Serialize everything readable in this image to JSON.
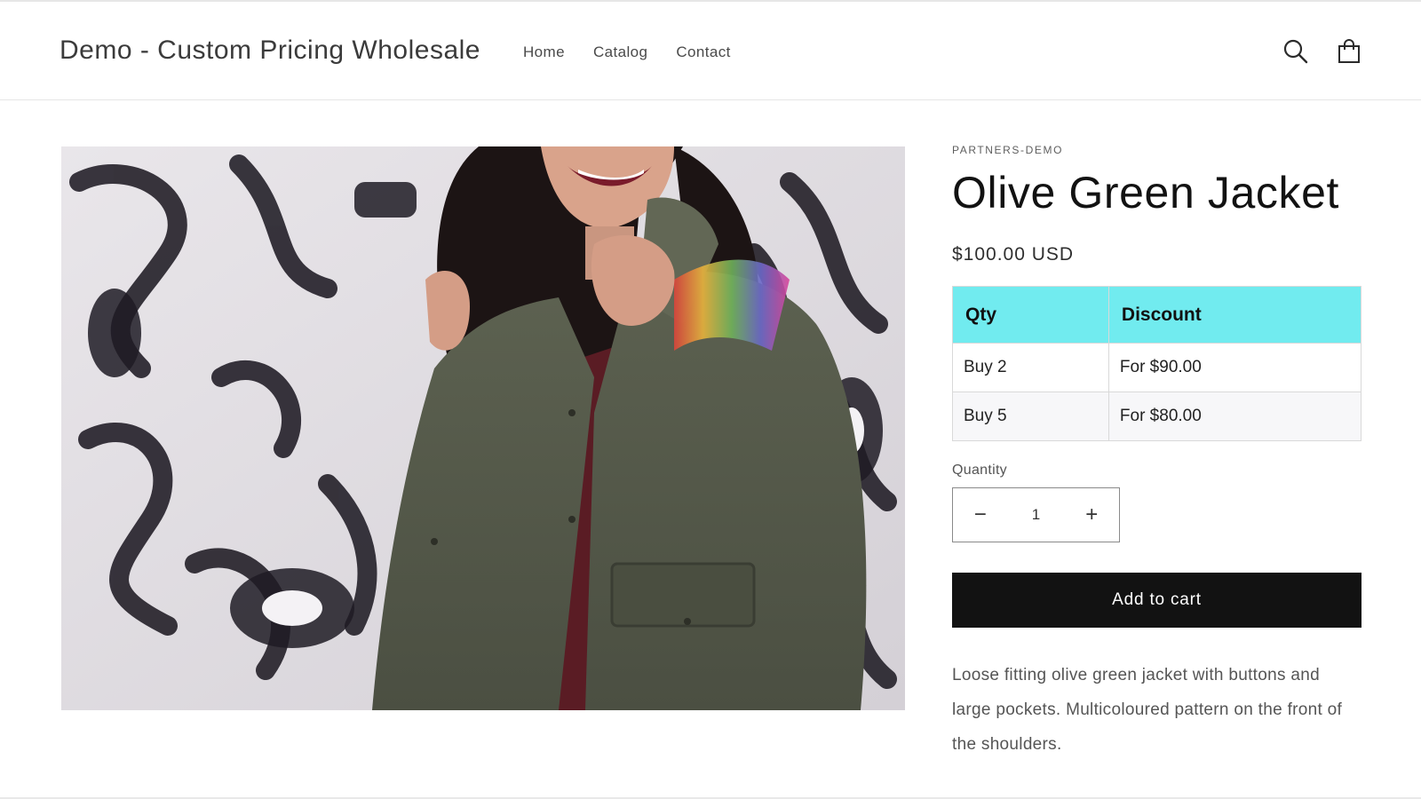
{
  "header": {
    "store_title": "Demo - Custom Pricing Wholesale",
    "nav": [
      {
        "label": "Home"
      },
      {
        "label": "Catalog"
      },
      {
        "label": "Contact"
      }
    ],
    "search_icon": "search-icon",
    "cart_icon": "cart-icon"
  },
  "product": {
    "image_alt": "Woman laughing wearing an olive green jacket in front of a graffiti wall",
    "vendor": "PARTNERS-DEMO",
    "title": "Olive Green Jacket",
    "price": "$100.00 USD",
    "discount_table": {
      "headers": [
        "Qty",
        "Discount"
      ],
      "rows": [
        {
          "qty": "Buy 2",
          "discount": "For $90.00"
        },
        {
          "qty": "Buy 5",
          "discount": "For $80.00"
        }
      ],
      "header_color": "#71ebef"
    },
    "quantity_label": "Quantity",
    "quantity_value": "1",
    "decrease_symbol": "−",
    "increase_symbol": "+",
    "add_to_cart_label": "Add to cart",
    "description": "Loose fitting olive green jacket with buttons and large pockets. Multicoloured pattern on the front of the shoulders."
  }
}
